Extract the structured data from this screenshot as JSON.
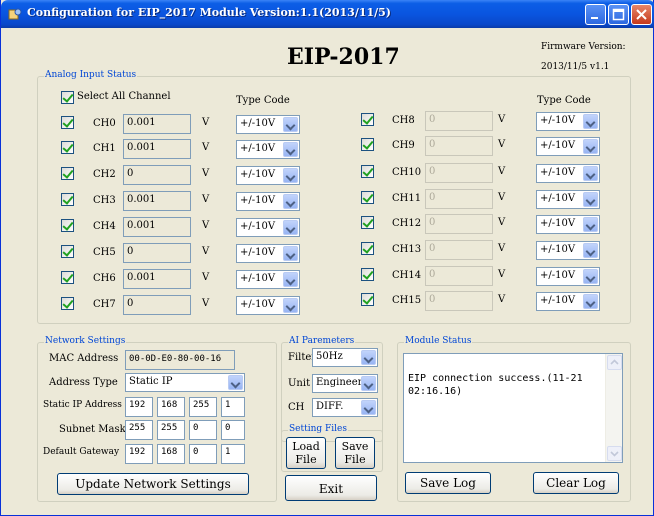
{
  "window": {
    "title": "Configuration for EIP_2017 Module Version:1.1(2013/11/5)"
  },
  "header": {
    "title": "EIP-2017",
    "firmware_label": "Firmware Version:",
    "firmware_value": "2013/11/5 v1.1"
  },
  "analog": {
    "group_label": "Analog Input Status",
    "select_all_label": "Select All Channel",
    "type_code_label": "Type Code",
    "unit": "V",
    "channels_left": [
      {
        "name": "CH0",
        "value": "0.001",
        "type": "+/-10V"
      },
      {
        "name": "CH1",
        "value": "0.001",
        "type": "+/-10V"
      },
      {
        "name": "CH2",
        "value": "0",
        "type": "+/-10V"
      },
      {
        "name": "CH3",
        "value": "0.001",
        "type": "+/-10V"
      },
      {
        "name": "CH4",
        "value": "0.001",
        "type": "+/-10V"
      },
      {
        "name": "CH5",
        "value": "0",
        "type": "+/-10V"
      },
      {
        "name": "CH6",
        "value": "0.001",
        "type": "+/-10V"
      },
      {
        "name": "CH7",
        "value": "0",
        "type": "+/-10V"
      }
    ],
    "channels_right": [
      {
        "name": "CH8",
        "value": "0",
        "type": "+/-10V"
      },
      {
        "name": "CH9",
        "value": "0",
        "type": "+/-10V"
      },
      {
        "name": "CH10",
        "value": "0",
        "type": "+/-10V"
      },
      {
        "name": "CH11",
        "value": "0",
        "type": "+/-10V"
      },
      {
        "name": "CH12",
        "value": "0",
        "type": "+/-10V"
      },
      {
        "name": "CH13",
        "value": "0",
        "type": "+/-10V"
      },
      {
        "name": "CH14",
        "value": "0",
        "type": "+/-10V"
      },
      {
        "name": "CH15",
        "value": "0",
        "type": "+/-10V"
      }
    ]
  },
  "network": {
    "group_label": "Network Settings",
    "mac_label": "MAC Address",
    "mac_value": "00-0D-E0-80-00-16",
    "address_type_label": "Address Type",
    "address_type_value": "Static IP",
    "static_ip_label": "Static IP Address",
    "static_ip": [
      "192",
      "168",
      "255",
      "1"
    ],
    "subnet_label": "Subnet Mask",
    "subnet": [
      "255",
      "255",
      "0",
      "0"
    ],
    "gateway_label": "Default Gateway",
    "gateway": [
      "192",
      "168",
      "0",
      "1"
    ],
    "update_button": "Update Network Settings"
  },
  "ai_params": {
    "group_label": "AI Paremeters",
    "filter_label": "Filter",
    "filter_value": "50Hz",
    "unit_label": "Unit",
    "unit_value": "Engineer",
    "ch_label": "CH",
    "ch_value": "DIFF."
  },
  "setting_files": {
    "group_label": "Setting Files",
    "load_line1": "Load",
    "load_line2": "File",
    "save_line1": "Save",
    "save_line2": "File"
  },
  "exit_button": "Exit",
  "module_status": {
    "group_label": "Module Status",
    "log_text": "EIP connection success.(11-21 02:16.16)",
    "save_log_button": "Save Log",
    "clear_log_button": "Clear Log"
  }
}
